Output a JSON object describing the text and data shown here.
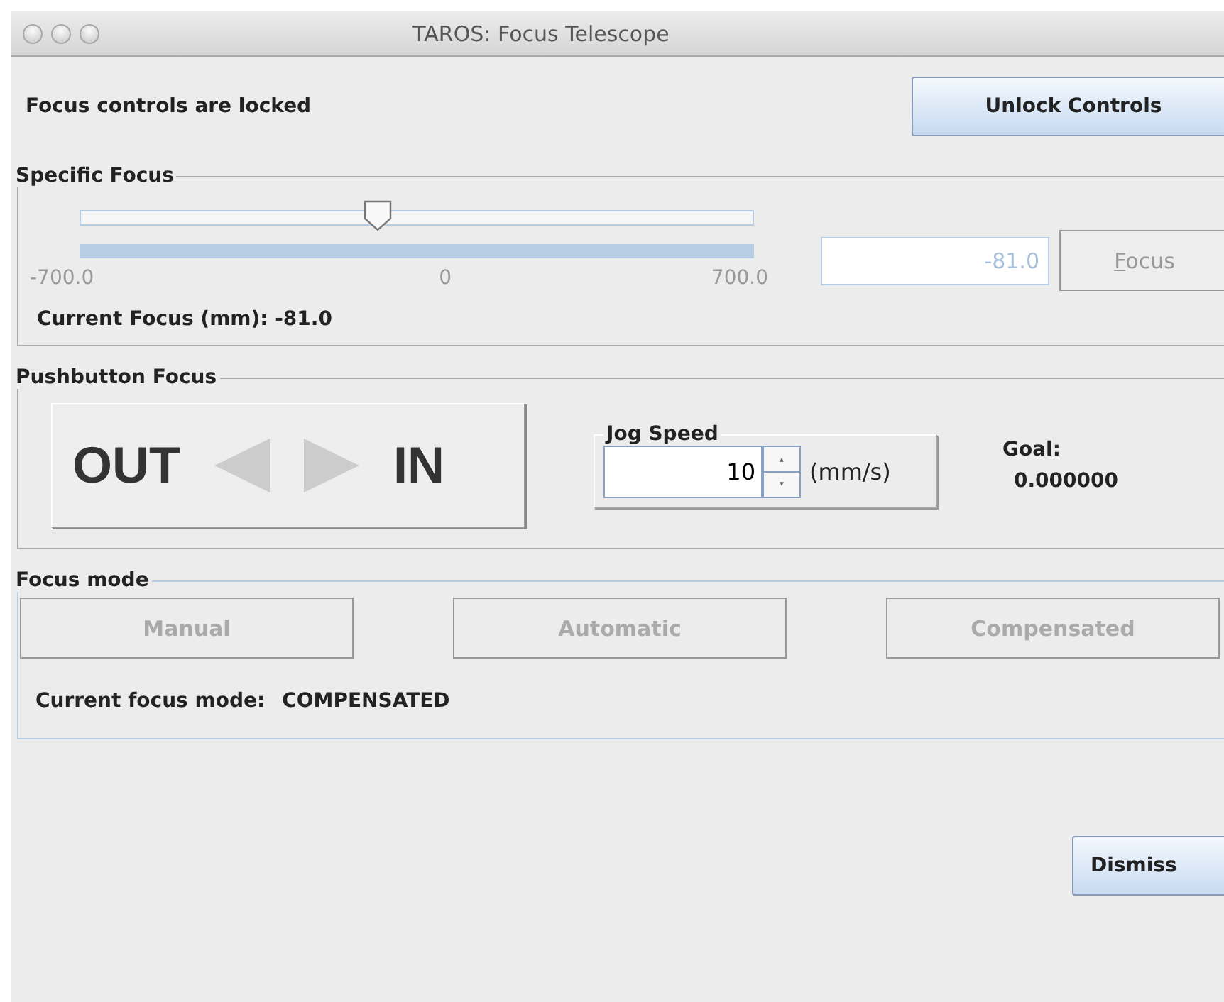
{
  "window": {
    "title": "TAROS: Focus Telescope"
  },
  "lock": {
    "status": "Focus controls are locked",
    "button": "Unlock Controls"
  },
  "specific_focus": {
    "title": "Specific Focus",
    "slider": {
      "level": 0.442,
      "disabled": true,
      "min_label": "-700.0",
      "mid_label": "0",
      "max_label": "700.0"
    },
    "field": {
      "value": "-81.0",
      "disabled": true
    },
    "button": {
      "label": "Focus",
      "disabled": true
    },
    "current": "Current Focus (mm): -81.0"
  },
  "pushbutton_focus": {
    "title": "Pushbutton Focus",
    "out_label": "OUT",
    "in_label": "IN",
    "arrows_disabled": true,
    "jog_speed": {
      "title": "Jog Speed",
      "value": "10",
      "unit": "(mm/s)"
    },
    "goal_label": "Goal:",
    "goal_value": "0.000000"
  },
  "focus_mode": {
    "title": "Focus mode",
    "buttons": [
      {
        "label": "Manual",
        "disabled": true
      },
      {
        "label": "Automatic",
        "disabled": true
      },
      {
        "label": "Compensated",
        "disabled": true
      }
    ],
    "current_label": "Current focus mode:",
    "current_value": "COMPENSATED"
  },
  "dismiss": "Dismiss"
}
